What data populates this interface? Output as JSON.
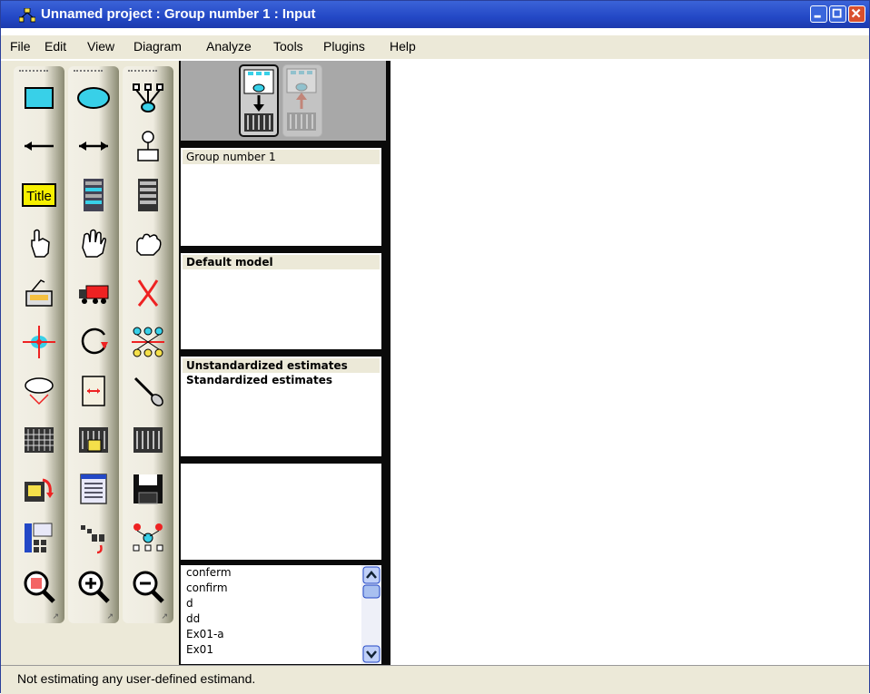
{
  "window": {
    "title": "Unnamed project : Group number 1 : Input"
  },
  "menu": [
    "File",
    "Edit",
    "View",
    "Diagram",
    "Analyze",
    "Tools",
    "Plugins",
    "Help"
  ],
  "panels": {
    "groups": {
      "header": "Group number 1"
    },
    "models": {
      "header": "Default model"
    },
    "estimates": {
      "selected": "Unstandardized estimates",
      "other": "Standardized estimates"
    }
  },
  "file_list": [
    "conferm",
    "confirm",
    "d",
    "dd",
    "Ex01-a",
    "Ex01"
  ],
  "status": "Not estimating any user-defined estimand.",
  "colors": {
    "title_bar": "#2348c6",
    "chrome": "#ece9d8",
    "toolbox_tile": "#efece0"
  },
  "toolbox_icons": [
    "rectangle-icon",
    "ellipse-icon",
    "indicator-icon",
    "arrow-left-icon",
    "double-arrow-icon",
    "unique-variable-icon",
    "title-icon",
    "list-variables-model-icon",
    "list-variables-dataset-icon",
    "select-one-hand-icon",
    "select-all-hand-icon",
    "deselect-hand-icon",
    "copy-icon",
    "move-truck-icon",
    "erase-icon",
    "move-parameter-icon",
    "rotate-icon",
    "reflect-icon",
    "shape-change-icon",
    "scroll-icon",
    "touch-up-icon",
    "data-files-icon",
    "analysis-properties-icon",
    "calculate-estimates-icon",
    "copy-diagram-icon",
    "text-output-icon",
    "save-icon",
    "object-properties-icon",
    "drag-properties-icon",
    "preserve-symmetries-icon",
    "zoom-select-icon",
    "zoom-in-icon",
    "zoom-out-icon"
  ]
}
